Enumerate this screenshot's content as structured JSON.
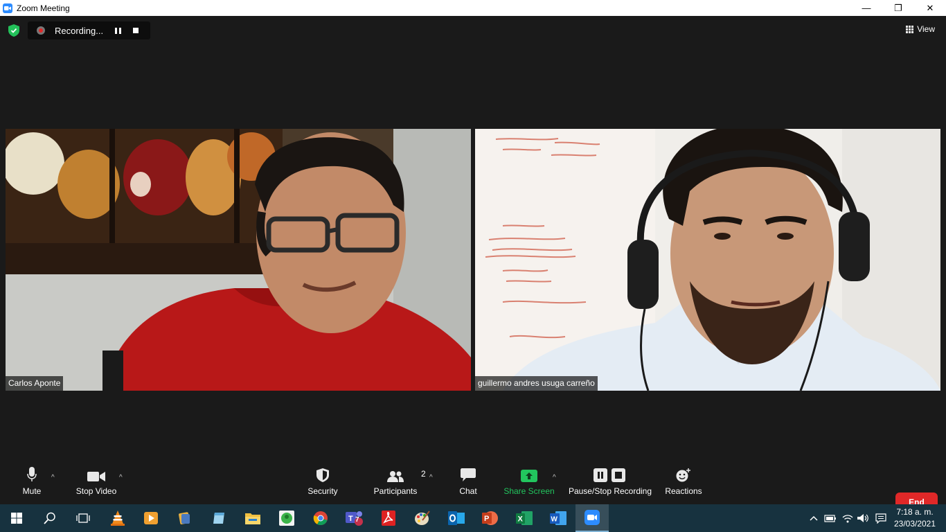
{
  "window": {
    "title": "Zoom Meeting",
    "minimize": "—",
    "restore": "❐",
    "close": "✕"
  },
  "topbar": {
    "recording_label": "Recording...",
    "view_label": "View"
  },
  "participants": [
    {
      "name": "Carlos Aponte"
    },
    {
      "name": "guillermo andres usuga carreño"
    }
  ],
  "toolbar": {
    "mute": "Mute",
    "stop_video": "Stop Video",
    "security": "Security",
    "participants": "Participants",
    "participants_count": "2",
    "chat": "Chat",
    "share_screen": "Share Screen",
    "pause_stop_recording": "Pause/Stop Recording",
    "reactions": "Reactions",
    "end": "End"
  },
  "colors": {
    "share_green": "#22c55e",
    "end_red": "#e02828",
    "meeting_bg": "#1a1a1a",
    "taskbar_bg": "#17323f"
  },
  "taskbar": {
    "icons": [
      "windows-start",
      "search",
      "task-view",
      "vlc",
      "media-player",
      "file-icon",
      "notepad",
      "file-explorer",
      "green-app",
      "chrome",
      "teams",
      "acrobat",
      "paint",
      "outlook",
      "powerpoint",
      "excel",
      "word",
      "zoom"
    ],
    "teams_badge": "7",
    "time": "7:18 a. m.",
    "date": "23/03/2021"
  }
}
